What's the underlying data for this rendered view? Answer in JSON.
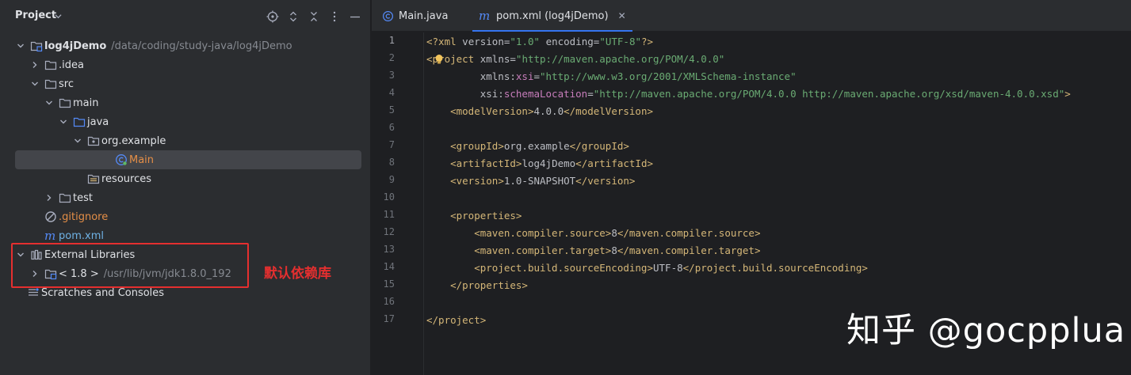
{
  "project_panel": {
    "title": "Project",
    "tools": [
      "locate-icon",
      "expand-all-icon",
      "collapse-all-icon",
      "more-options-icon",
      "minimize-icon"
    ],
    "tree": [
      {
        "label": "log4jDemo",
        "path": "/data/coding/study-java/log4jDemo",
        "icon": "module-folder-icon"
      },
      {
        "label": ".idea",
        "icon": "folder-icon"
      },
      {
        "label": "src",
        "icon": "folder-icon"
      },
      {
        "label": "main",
        "icon": "folder-icon"
      },
      {
        "label": "java",
        "icon": "source-folder-icon"
      },
      {
        "label": "org.example",
        "icon": "package-icon"
      },
      {
        "label": "Main",
        "icon": "class-icon"
      },
      {
        "label": "resources",
        "icon": "resources-folder-icon"
      },
      {
        "label": "test",
        "icon": "folder-icon"
      },
      {
        "label": ".gitignore",
        "icon": "ignore-file-icon"
      },
      {
        "label": "pom.xml",
        "icon": "maven-icon"
      },
      {
        "label": "External Libraries",
        "icon": "libraries-icon"
      },
      {
        "label": "< 1.8 >",
        "path": "/usr/lib/jvm/jdk1.8.0_192",
        "icon": "jdk-icon"
      },
      {
        "label": "Scratches and Consoles",
        "icon": "scratches-icon"
      }
    ]
  },
  "annotation": {
    "text": "默认依赖库",
    "color": "#e52f2f"
  },
  "editor": {
    "tabs": [
      {
        "label": "Main.java",
        "icon": "class-icon",
        "active": false
      },
      {
        "label": "pom.xml (log4jDemo)",
        "icon": "maven-icon",
        "active": true,
        "close": "✕"
      }
    ],
    "line_numbers": [
      "1",
      "2",
      "3",
      "4",
      "5",
      "6",
      "7",
      "8",
      "9",
      "10",
      "11",
      "12",
      "13",
      "14",
      "15",
      "16",
      "17"
    ],
    "code_lines": [
      "<?xml version=\"1.0\" encoding=\"UTF-8\"?>",
      "<project xmlns=\"http://maven.apache.org/POM/4.0.0\"",
      "         xmlns:xsi=\"http://www.w3.org/2001/XMLSchema-instance\"",
      "         xsi:schemaLocation=\"http://maven.apache.org/POM/4.0.0 http://maven.apache.org/xsd/maven-4.0.0.xsd\">",
      "    <modelVersion>4.0.0</modelVersion>",
      "",
      "    <groupId>org.example</groupId>",
      "    <artifactId>log4jDemo</artifactId>",
      "    <version>1.0-SNAPSHOT</version>",
      "",
      "    <properties>",
      "        <maven.compiler.source>8</maven.compiler.source>",
      "        <maven.compiler.target>8</maven.compiler.target>",
      "        <project.build.sourceEncoding>UTF-8</project.build.sourceEncoding>",
      "    </properties>",
      "",
      "</project>"
    ]
  },
  "watermark": "知乎 @gocpplua"
}
